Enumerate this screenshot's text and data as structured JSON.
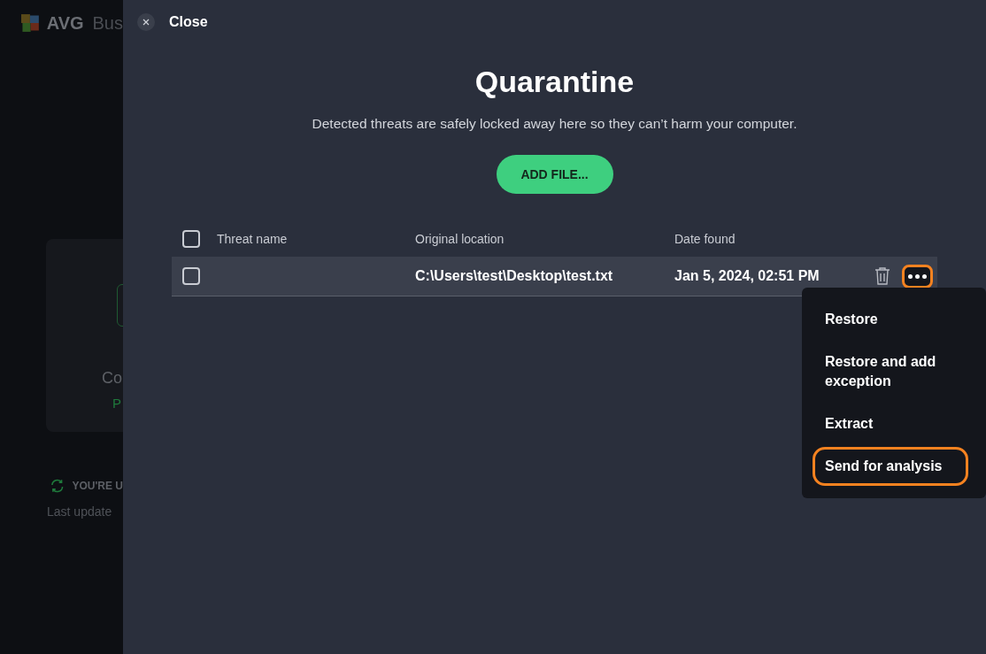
{
  "background_app": {
    "logo_text": "AVG",
    "product_text": "Bus",
    "card": {
      "title": "Co",
      "status": "P"
    },
    "update_status": "YOU'RE U",
    "last_updated": "Last update"
  },
  "close_button": {
    "label": "Close"
  },
  "title": "Quarantine",
  "subtitle": "Detected threats are safely locked away here so they can’t harm your computer.",
  "add_button": {
    "label": "ADD FILE..."
  },
  "table": {
    "select_all_checked": false,
    "columns": [
      "Threat name",
      "Original location",
      "Date found"
    ],
    "rows": [
      {
        "checked": false,
        "location": "C:\\Users\\test\\Desktop\\test.txt",
        "date": "Jan 5, 2024, 02:51 PM",
        "more_highlighted": true
      }
    ]
  },
  "context_menu": {
    "items": [
      {
        "label": "Restore",
        "highlighted": false
      },
      {
        "label": "Restore and add exception",
        "highlighted": false
      },
      {
        "label": "Extract",
        "highlighted": false
      },
      {
        "label": "Send for analysis",
        "highlighted": true
      }
    ]
  }
}
